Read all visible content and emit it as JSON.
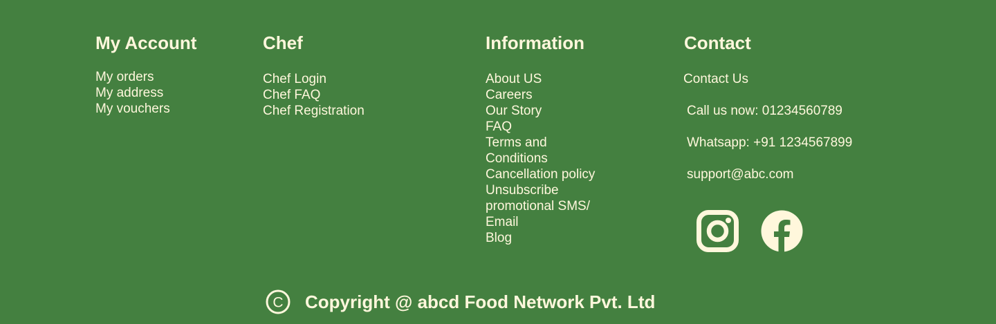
{
  "colors": {
    "background": "#448040",
    "text": "#fff7dc"
  },
  "account": {
    "heading": "My Account",
    "links": [
      "My orders",
      "My address",
      "My vouchers"
    ]
  },
  "chef": {
    "heading": "Chef",
    "links": [
      "Chef Login",
      "Chef FAQ",
      "Chef Registration"
    ]
  },
  "information": {
    "heading": "Information",
    "links": [
      "About US",
      "Careers",
      "Our Story",
      "FAQ",
      "Terms and Conditions",
      "Cancellation policy",
      "Unsubscribe promotional SMS/ Email",
      "Blog"
    ]
  },
  "contact": {
    "heading": "Contact",
    "contact_us": "Contact Us",
    "phone": "Call us now: 01234560789",
    "whatsapp": "Whatsapp: +91 1234567899",
    "email": "support@abc.com",
    "social_icons": [
      "instagram-icon",
      "facebook-icon"
    ]
  },
  "footer": {
    "copyright_icon": "copyright-icon",
    "copyright": "Copyright @ abcd Food Network Pvt. Ltd"
  }
}
